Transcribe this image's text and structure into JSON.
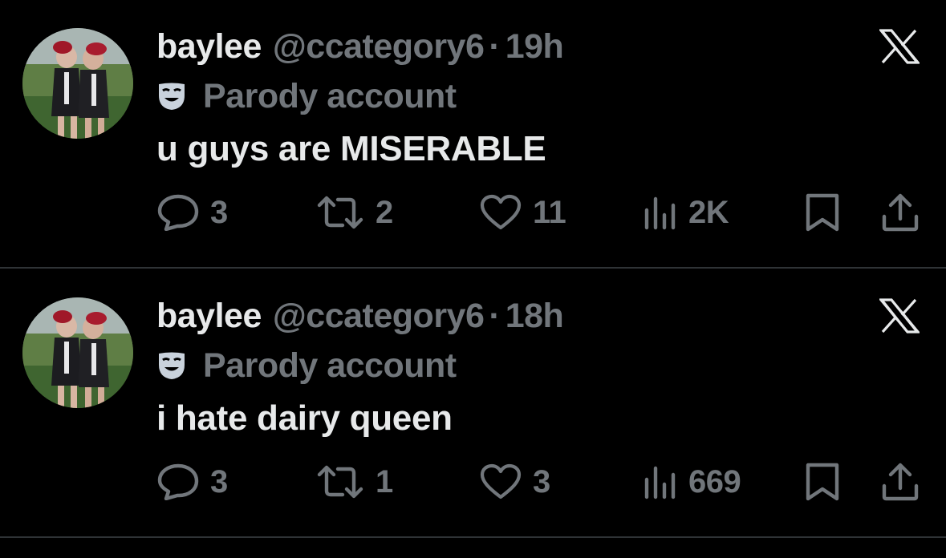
{
  "colors": {
    "background": "#000000",
    "primary_text": "#e7e9ea",
    "secondary_text": "#71767b",
    "divider": "#2f3336"
  },
  "tweets": [
    {
      "display_name": "baylee",
      "handle": "@ccategory6",
      "separator": "·",
      "time": "19h",
      "label_icon": "parody-mask-icon",
      "label": "Parody account",
      "text": "u guys are MISERABLE",
      "actions": {
        "replies": "3",
        "reposts": "2",
        "likes": "11",
        "views": "2K"
      }
    },
    {
      "display_name": "baylee",
      "handle": "@ccategory6",
      "separator": "·",
      "time": "18h",
      "label_icon": "parody-mask-icon",
      "label": "Parody account",
      "text": "i hate dairy queen",
      "actions": {
        "replies": "3",
        "reposts": "1",
        "likes": "3",
        "views": "669"
      }
    }
  ]
}
